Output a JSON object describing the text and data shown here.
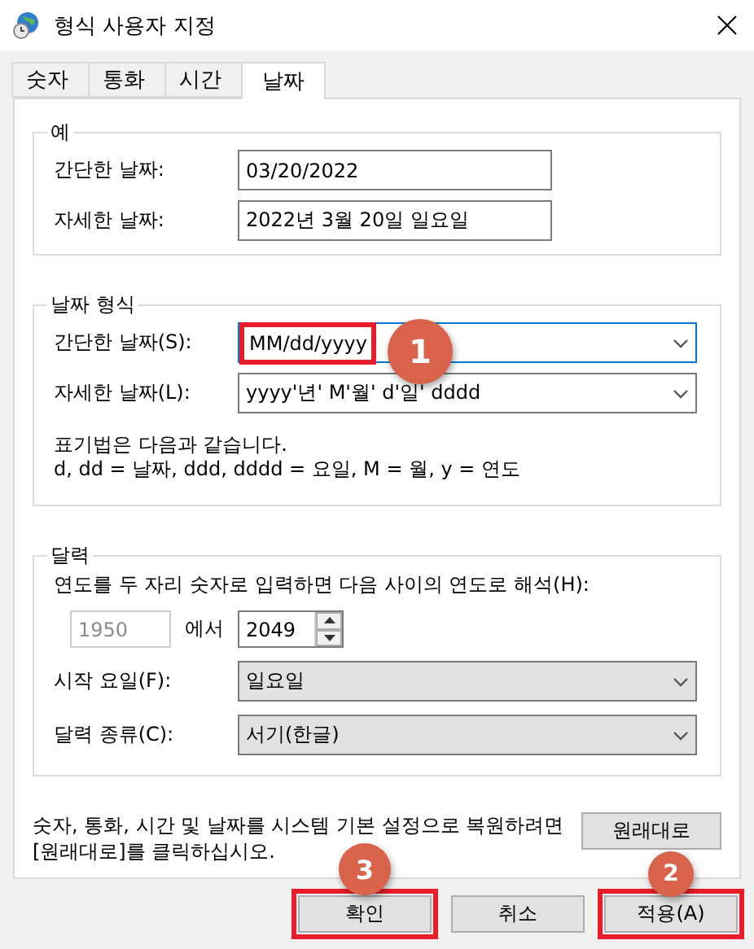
{
  "window": {
    "title": "형식 사용자 지정"
  },
  "tabs": [
    {
      "label": "숫자",
      "selected": false
    },
    {
      "label": "통화",
      "selected": false
    },
    {
      "label": "시간",
      "selected": false
    },
    {
      "label": "날짜",
      "selected": true
    }
  ],
  "example": {
    "title": "예",
    "rows": [
      {
        "label": "간단한 날짜:",
        "value": "03/20/2022"
      },
      {
        "label": "자세한 날짜:",
        "value": "2022년 3월 20일 일요일"
      }
    ]
  },
  "date_format": {
    "title": "날짜 형식",
    "rows": [
      {
        "label": "간단한 날짜(S):",
        "value": "MM/dd/yyyy",
        "kind": "editable",
        "focused": true,
        "highlighted": true,
        "badge": "1"
      },
      {
        "label": "자세한 날짜(L):",
        "value": "yyyy'년' M'월' d'일' dddd",
        "kind": "editable",
        "focused": false,
        "highlighted": false
      }
    ],
    "notes": [
      "표기법은 다음과 같습니다.",
      "d, dd = 날짜,  ddd, dddd = 요일,  M = 월,  y = 연도"
    ]
  },
  "calendar": {
    "title": "달력",
    "two_digit_label": "연도를 두 자리 숫자로 입력하면 다음 사이의 연도로 해석(H):",
    "from": {
      "value": "1950",
      "disabled": true
    },
    "connector": "에서",
    "to": {
      "value": "2049",
      "disabled": false
    },
    "rows": [
      {
        "label": "시작 요일(F):",
        "value": "일요일",
        "kind": "list",
        "focused": false,
        "highlighted": false
      },
      {
        "label": "달력 종류(C):",
        "value": "서기(한글)",
        "kind": "list",
        "focused": false,
        "highlighted": false
      }
    ]
  },
  "reset": {
    "text": "숫자, 통화, 시간 및 날짜를 시스템 기본 설정으로 복원하려면 [원래대로]를 클릭하십시오.",
    "button": "원래대로"
  },
  "buttons": [
    {
      "label": "확인",
      "highlighted": true,
      "badge": "3"
    },
    {
      "label": "취소",
      "highlighted": false
    },
    {
      "label": "적용(A)",
      "highlighted": true,
      "badge": "2"
    }
  ]
}
